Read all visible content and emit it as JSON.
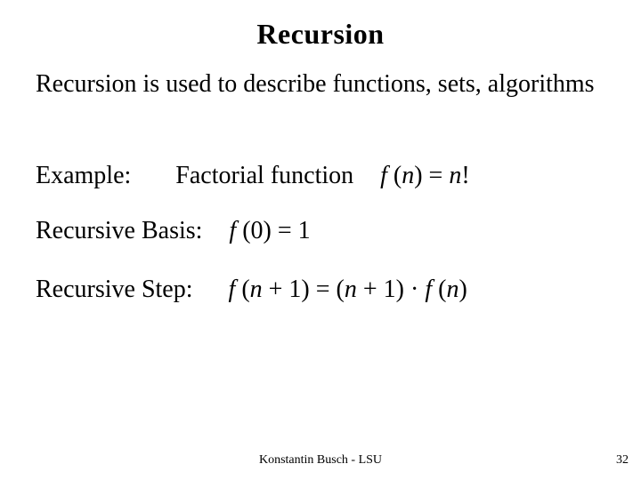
{
  "title": "Recursion",
  "intro": "Recursion is used to describe functions, sets, algorithms",
  "example": {
    "label": "Example:",
    "text": "Factorial function",
    "formula_fn": "f (n) = n!"
  },
  "basis": {
    "label": "Recursive Basis:",
    "formula": "f (0) = 1"
  },
  "step": {
    "label": "Recursive Step:",
    "formula": "f (n + 1) = (n + 1) · f (n)"
  },
  "footer": "Konstantin Busch - LSU",
  "page": "32"
}
